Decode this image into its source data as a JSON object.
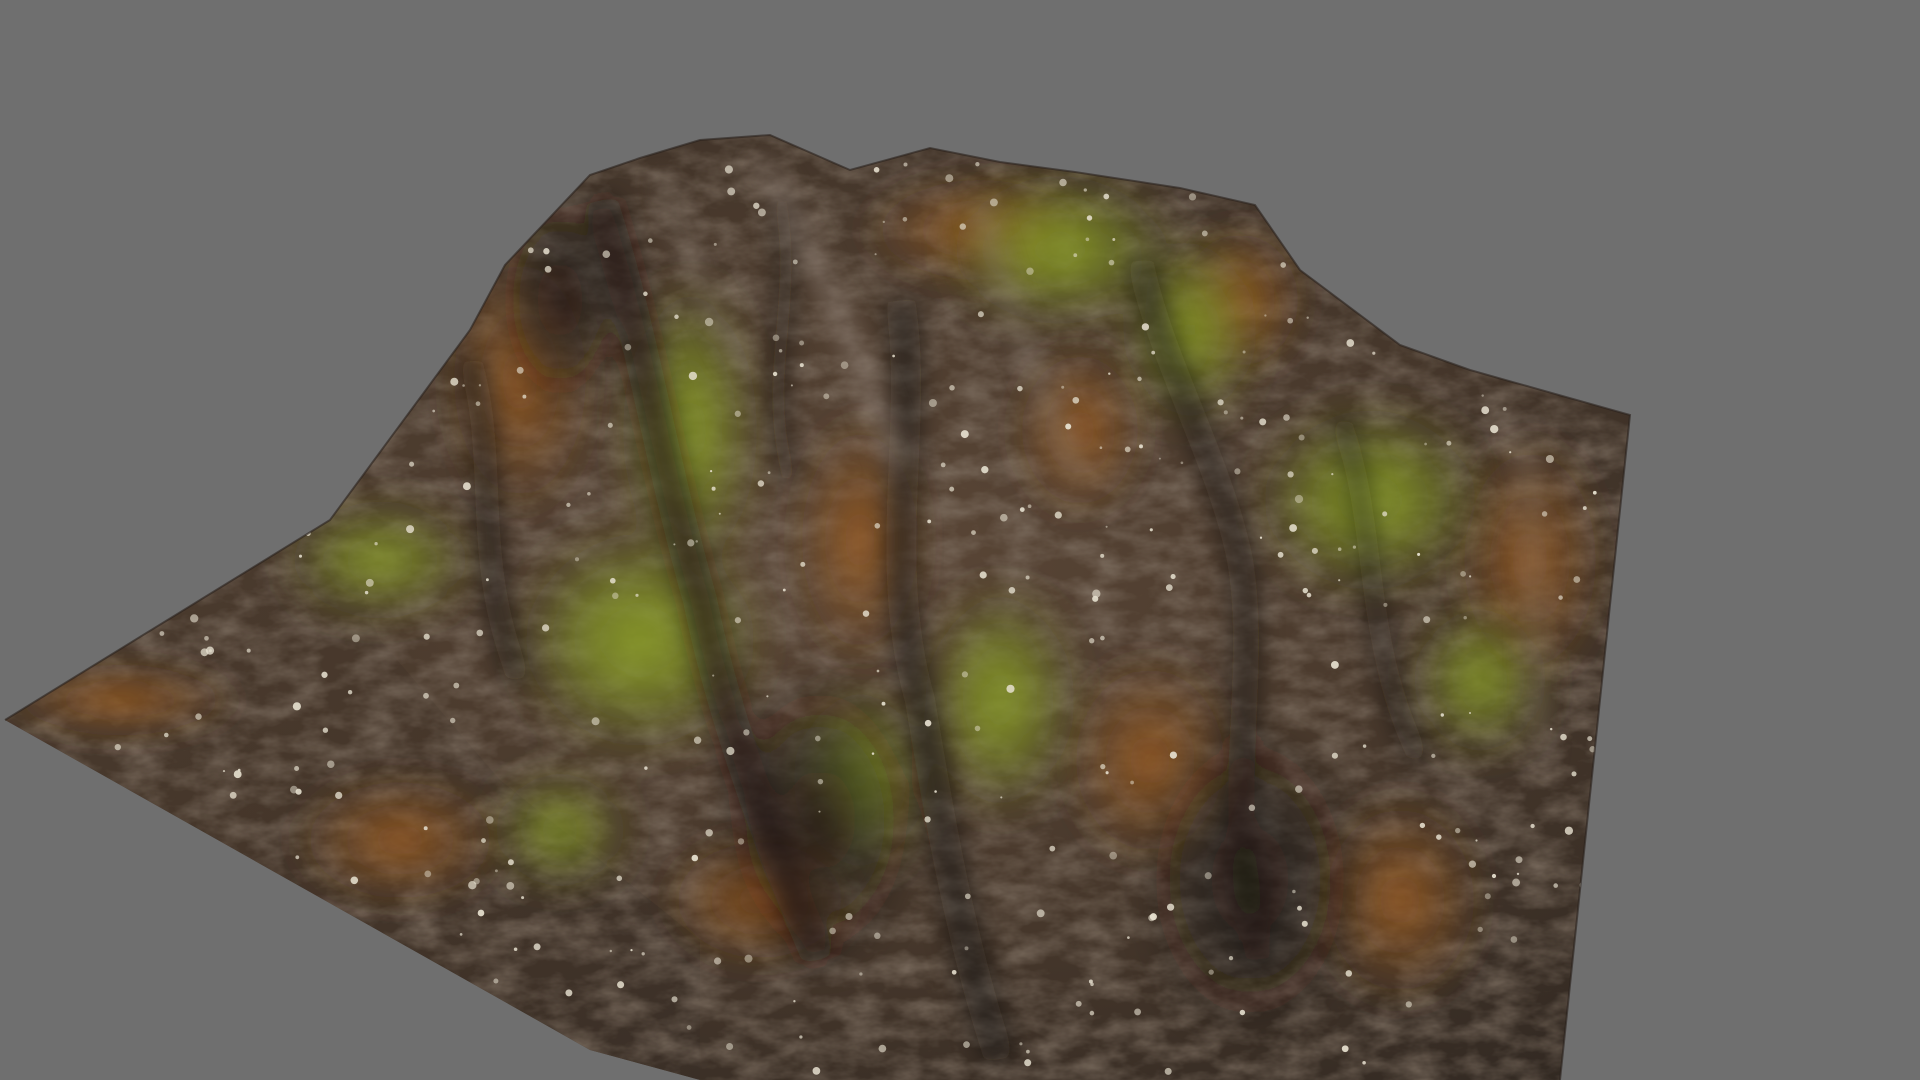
{
  "viewport": {
    "background_color": "#6f6f6f"
  },
  "model": {
    "subject": "rock-terrain-mesh",
    "material_colors": {
      "rock_dark": "#3a2e26",
      "rock_mid": "#5a4535",
      "rust_orange": "#8a5522",
      "moss_green": "#7f9420",
      "lichen_white": "#e6e0cf"
    }
  }
}
